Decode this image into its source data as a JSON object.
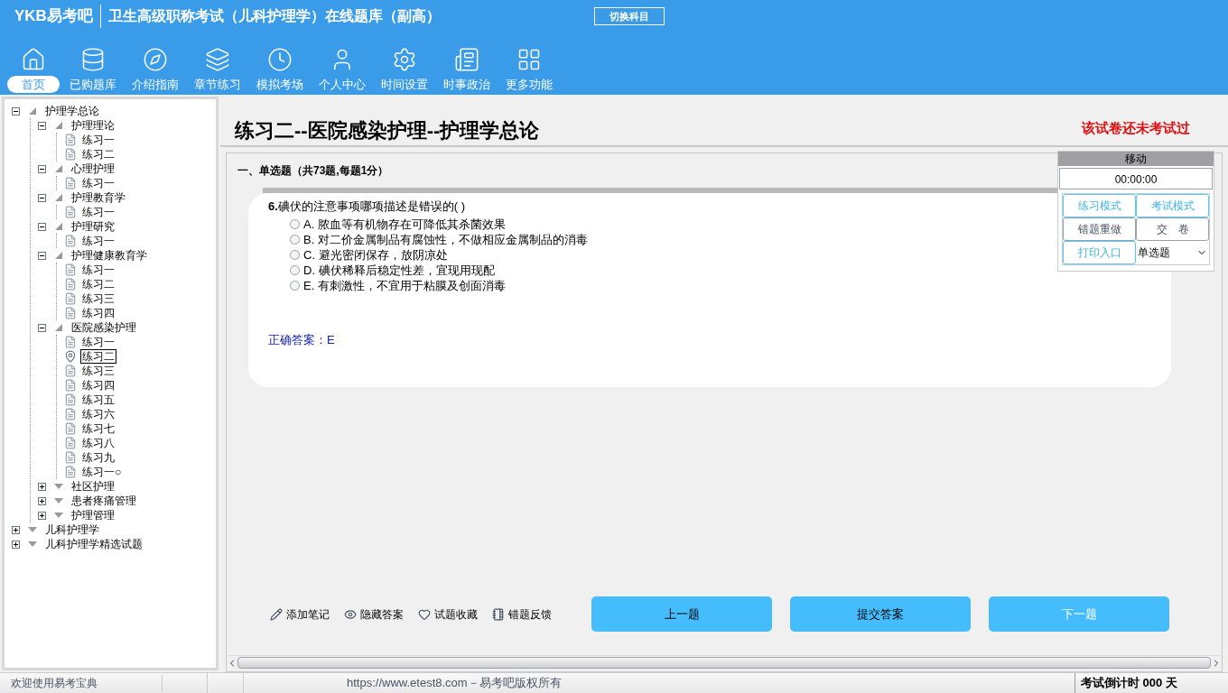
{
  "header": {
    "logo": "YKB易考吧",
    "title": "卫生高级职称考试（儿科护理学）在线题库（副高）",
    "switch_button": "切换科目"
  },
  "nav": [
    {
      "kind": "home",
      "label": "首页",
      "selected": true
    },
    {
      "kind": "database",
      "label": "已购题库",
      "selected": false
    },
    {
      "kind": "compass",
      "label": "介绍指南",
      "selected": false
    },
    {
      "kind": "layers",
      "label": "章节练习",
      "selected": false
    },
    {
      "kind": "clock",
      "label": "模拟考场",
      "selected": false
    },
    {
      "kind": "user",
      "label": "个人中心",
      "selected": false
    },
    {
      "kind": "settings",
      "label": "时间设置",
      "selected": false
    },
    {
      "kind": "news",
      "label": "时事政治",
      "selected": false
    },
    {
      "kind": "grid",
      "label": "更多功能",
      "selected": false
    }
  ],
  "tree": [
    {
      "label": "护理学总论",
      "expanded": true,
      "children": [
        {
          "label": "护理理论",
          "expanded": true,
          "children": [
            {
              "label": "练习一",
              "selected": false
            },
            {
              "label": "练习二",
              "selected": false
            }
          ]
        },
        {
          "label": "心理护理",
          "expanded": true,
          "children": [
            {
              "label": "练习一",
              "selected": false
            }
          ]
        },
        {
          "label": "护理教育学",
          "expanded": true,
          "children": [
            {
              "label": "练习一",
              "selected": false
            }
          ]
        },
        {
          "label": "护理研究",
          "expanded": true,
          "children": [
            {
              "label": "练习一",
              "selected": false
            }
          ]
        },
        {
          "label": "护理健康教育学",
          "expanded": true,
          "children": [
            {
              "label": "练习一",
              "selected": false
            },
            {
              "label": "练习二",
              "selected": false
            },
            {
              "label": "练习三",
              "selected": false
            },
            {
              "label": "练习四",
              "selected": false
            }
          ]
        },
        {
          "label": "医院感染护理",
          "expanded": true,
          "children": [
            {
              "label": "练习一",
              "selected": false
            },
            {
              "label": "练习二",
              "selected": true
            },
            {
              "label": "练习三",
              "selected": false
            },
            {
              "label": "练习四",
              "selected": false
            },
            {
              "label": "练习五",
              "selected": false
            },
            {
              "label": "练习六",
              "selected": false
            },
            {
              "label": "练习七",
              "selected": false
            },
            {
              "label": "练习八",
              "selected": false
            },
            {
              "label": "练习九",
              "selected": false
            },
            {
              "label": "练习一○",
              "selected": false
            }
          ]
        },
        {
          "label": "社区护理",
          "expanded": false
        },
        {
          "label": "患者疼痛管理",
          "expanded": false
        },
        {
          "label": "护理管理",
          "expanded": false
        }
      ]
    },
    {
      "label": "儿科护理学",
      "expanded": false
    },
    {
      "label": "儿科护理学精选试题",
      "expanded": false
    }
  ],
  "paper": {
    "title": "练习二--医院感染护理--护理学总论",
    "status": "该试卷还未考试过",
    "section": "一、单选题（共73题,每题1分）"
  },
  "question": {
    "number": "6.",
    "text": "碘伏的注意事项哪项描述是错误的( )",
    "options": [
      {
        "letter": "A.",
        "text": "脓血等有机物存在可降低其杀菌效果",
        "selected": false
      },
      {
        "letter": "B.",
        "text": "对二价金属制品有腐蚀性，不做相应金属制品的消毒",
        "selected": false
      },
      {
        "letter": "C.",
        "text": "避光密闭保存，放阴凉处",
        "selected": false
      },
      {
        "letter": "D.",
        "text": "碘伏稀释后稳定性差，宜现用现配",
        "selected": false
      },
      {
        "letter": "E.",
        "text": "有刺激性，不宜用于粘膜及创面消毒",
        "selected": false
      }
    ],
    "answer": "正确答案：E"
  },
  "side_panel": {
    "title": "移动",
    "timer": "00:00:00",
    "buttons": [
      {
        "label": "练习模式",
        "kind": "accent"
      },
      {
        "label": "考试模式",
        "kind": "accent"
      },
      {
        "label": "错题重做",
        "kind": "plain"
      },
      {
        "label": "交　卷",
        "kind": "plain"
      },
      {
        "label": "打印入口",
        "kind": "accent"
      }
    ],
    "type_select": "单选题"
  },
  "tools": [
    {
      "kind": "pencil",
      "label": "添加笔记"
    },
    {
      "kind": "eye",
      "label": "隐藏答案"
    },
    {
      "kind": "heart",
      "label": "试题收藏"
    },
    {
      "kind": "notebook",
      "label": "错题反馈"
    }
  ],
  "actions": [
    {
      "label": "上一题",
      "kind": "dark"
    },
    {
      "label": "提交答案",
      "kind": "dark"
    },
    {
      "label": "下一题",
      "kind": "light"
    }
  ],
  "status_bar": {
    "welcome": "欢迎使用易考宝典",
    "copyright": "https://www.etest8.com－易考吧版权所有",
    "countdown": "考试倒计时 000 天"
  }
}
